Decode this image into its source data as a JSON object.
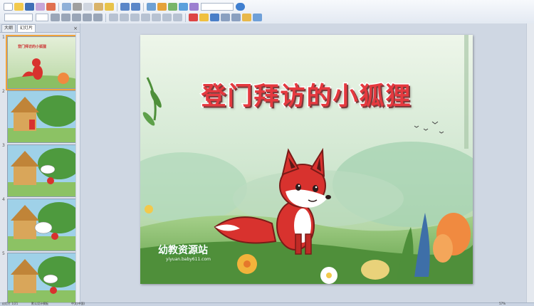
{
  "toolbar": {
    "row1_icons": [
      "new-icon",
      "open-icon",
      "save-icon",
      "print-icon",
      "preview-icon",
      "spell-icon",
      "cut-icon",
      "copy-icon",
      "paste-icon",
      "format-painter-icon",
      "undo-icon",
      "redo-icon",
      "insert-table-icon",
      "insert-chart-icon",
      "insert-picture-icon",
      "insert-textbox-icon",
      "insert-shape-icon",
      "zoom-icon",
      "help-icon"
    ],
    "row2_icons": [
      "bold-icon",
      "italic-icon",
      "underline-icon",
      "strike-icon",
      "shadow-icon",
      "align-left-icon",
      "align-center-icon",
      "align-right-icon",
      "bullets-icon",
      "numbering-icon",
      "indent-icon",
      "outdent-icon",
      "font-color-icon",
      "fill-icon",
      "line-icon",
      "arrange-icon",
      "slide-layout-icon",
      "new-slide-icon",
      "design-icon"
    ]
  },
  "left_pane": {
    "tab_outline": "大纲",
    "tab_slides": "幻灯片",
    "close_glyph": "×",
    "thumbnails": [
      {
        "number": "1",
        "label": "登门拜访的小狐狸",
        "selected": true
      },
      {
        "number": "2",
        "label": "",
        "selected": false
      },
      {
        "number": "3",
        "label": "",
        "selected": false
      },
      {
        "number": "4",
        "label": "",
        "selected": false
      },
      {
        "number": "5",
        "label": "",
        "selected": false
      }
    ]
  },
  "slide": {
    "title": "登门拜访的小狐狸",
    "watermark": "幼教资源站",
    "watermark_url": "yiyuan.baby611.com"
  },
  "status": {
    "slide_counter": "幻灯片 1/21",
    "theme": "默认设计模板",
    "language": "中文(中国)",
    "zoom": "57%"
  },
  "colors": {
    "title_red": "#e5393f",
    "selection_orange": "#f0a33a",
    "fox_red": "#d8322e"
  }
}
